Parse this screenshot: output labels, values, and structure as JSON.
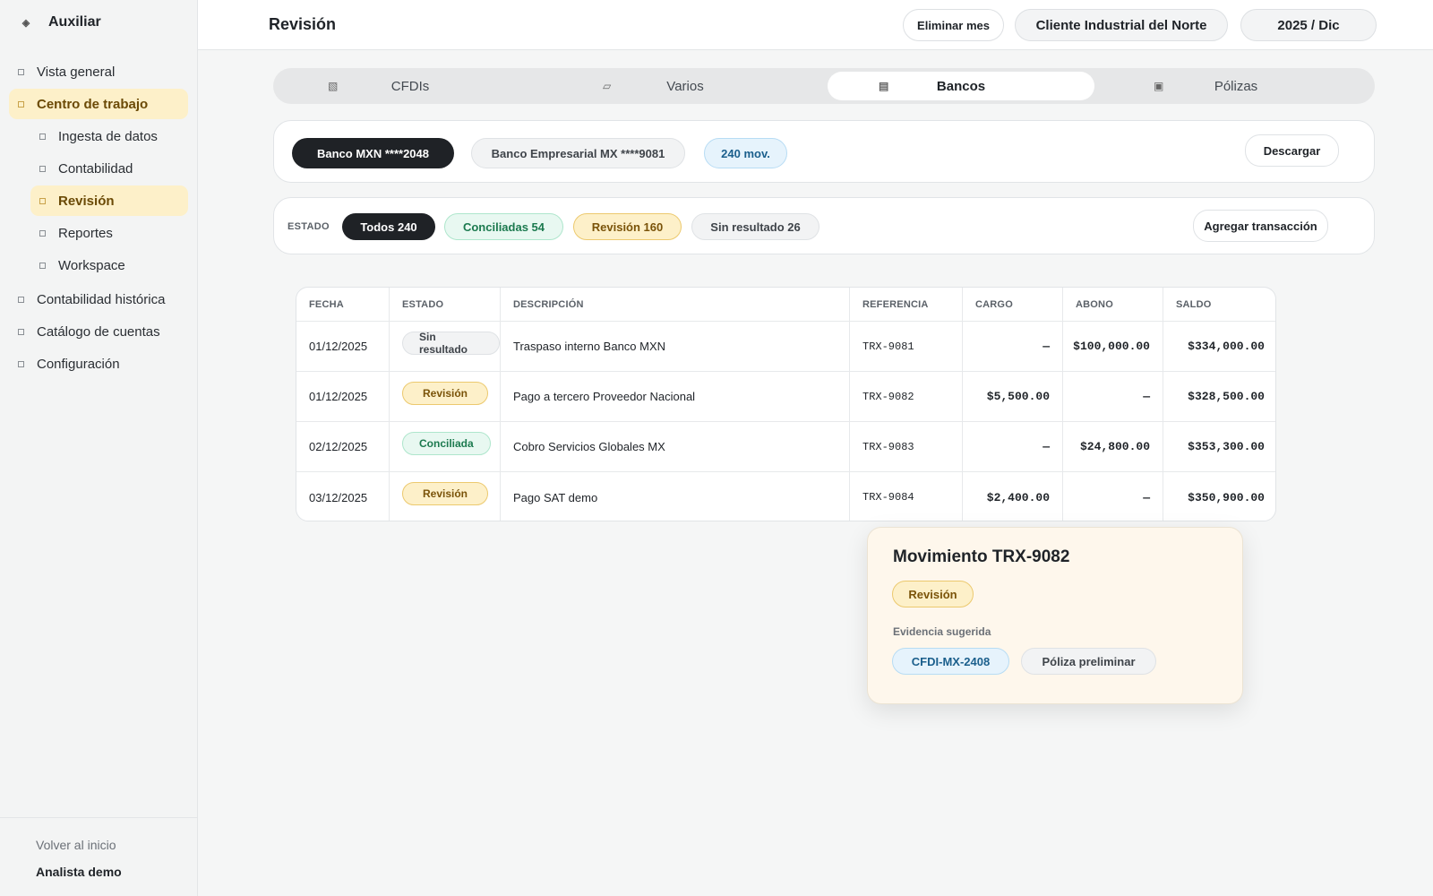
{
  "sidebar": {
    "brand": "Auxiliar",
    "brand_icon": "diamond-icon",
    "items": [
      {
        "label": "Vista general"
      },
      {
        "label": "Centro de trabajo"
      },
      {
        "label": "Ingesta de datos"
      },
      {
        "label": "Contabilidad"
      },
      {
        "label": "Revisión"
      },
      {
        "label": "Reportes"
      },
      {
        "label": "Workspace"
      },
      {
        "label": "Contabilidad histórica"
      },
      {
        "label": "Catálogo de cuentas"
      },
      {
        "label": "Configuración"
      }
    ],
    "back_label": "Volver al inicio",
    "user_name": "Analista demo"
  },
  "header": {
    "title": "Revisión",
    "delete_label": "Eliminar mes",
    "client_label": "Cliente Industrial del Norte",
    "period_label": "2025 / Dic"
  },
  "tabs": [
    {
      "label": "CFDIs",
      "icon": "grid-icon"
    },
    {
      "label": "Varios",
      "icon": "folder-icon"
    },
    {
      "label": "Bancos",
      "icon": "bank-icon"
    },
    {
      "label": "Pólizas",
      "icon": "ledger-icon"
    }
  ],
  "accounts": {
    "selected": "Banco MXN ****2048",
    "other": "Banco Empresarial MX ****9081",
    "count_badge": "240 mov.",
    "download_label": "Descargar"
  },
  "filters": {
    "label": "ESTADO",
    "all": "Todos 240",
    "reconciled": "Conciliadas 54",
    "review": "Revisión 160",
    "no_result": "Sin resultado 26",
    "add_label": "Agregar transacción"
  },
  "table": {
    "headers": [
      "FECHA",
      "ESTADO",
      "DESCRIPCIÓN",
      "REFERENCIA",
      "CARGO",
      "ABONO",
      "SALDO"
    ],
    "rows": [
      {
        "fecha": "01/12/2025",
        "estado": "Sin resultado",
        "descripcion": "Traspaso interno Banco MXN",
        "referencia": "TRX-9081",
        "cargo": "—",
        "abono": "$100,000.00",
        "saldo": "$334,000.00"
      },
      {
        "fecha": "01/12/2025",
        "estado": "Revisión",
        "descripcion": "Pago a tercero Proveedor Nacional",
        "referencia": "TRX-9082",
        "cargo": "$5,500.00",
        "abono": "—",
        "saldo": "$328,500.00"
      },
      {
        "fecha": "02/12/2025",
        "estado": "Conciliada",
        "descripcion": "Cobro Servicios Globales MX",
        "referencia": "TRX-9083",
        "cargo": "—",
        "abono": "$24,800.00",
        "saldo": "$353,300.00"
      },
      {
        "fecha": "03/12/2025",
        "estado": "Revisión",
        "descripcion": "Pago SAT demo",
        "referencia": "TRX-9084",
        "cargo": "$2,400.00",
        "abono": "—",
        "saldo": "$350,900.00"
      }
    ]
  },
  "popover": {
    "title": "Movimiento TRX-9082",
    "status": "Revisión",
    "evidence_label": "Evidencia sugerida",
    "evidence": [
      "CFDI-MX-2408",
      "Póliza preliminar"
    ]
  },
  "colors": {
    "accent_active": "#fdf0c9",
    "dark_pill": "#1f2226",
    "success": "#1c7a4f",
    "warning": "#7a5309",
    "info": "#1b5f8c"
  }
}
